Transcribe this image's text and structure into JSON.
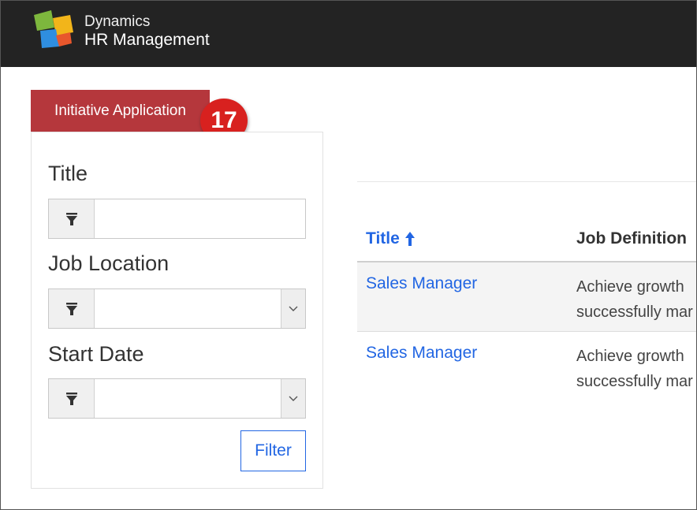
{
  "header": {
    "brand_line1": "Dynamics",
    "brand_line2": "HR Management",
    "background": "#232323"
  },
  "tab": {
    "label": "Initiative Application",
    "color": "#b5373c"
  },
  "badge": {
    "value": "17",
    "color": "#d8211f"
  },
  "filters": {
    "title_label": "Title",
    "title_value": "",
    "job_location_label": "Job Location",
    "job_location_value": "",
    "start_date_label": "Start Date",
    "start_date_value": "",
    "filter_icon": "funnel-icon",
    "dropdown_icon": "chevron-down-icon",
    "filter_button_label": "Filter"
  },
  "table": {
    "columns": [
      {
        "label": "Title",
        "sort": "ascending",
        "sort_icon": "arrow-up-icon"
      },
      {
        "label": "Job Definition"
      }
    ],
    "rows": [
      {
        "title": "Sales Manager",
        "job_definition_line1": "Achieve growth",
        "job_definition_line2": "successfully mar"
      },
      {
        "title": "Sales Manager",
        "job_definition_line1": "Achieve growth",
        "job_definition_line2": "successfully mar"
      }
    ],
    "link_color": "#2266e3"
  }
}
